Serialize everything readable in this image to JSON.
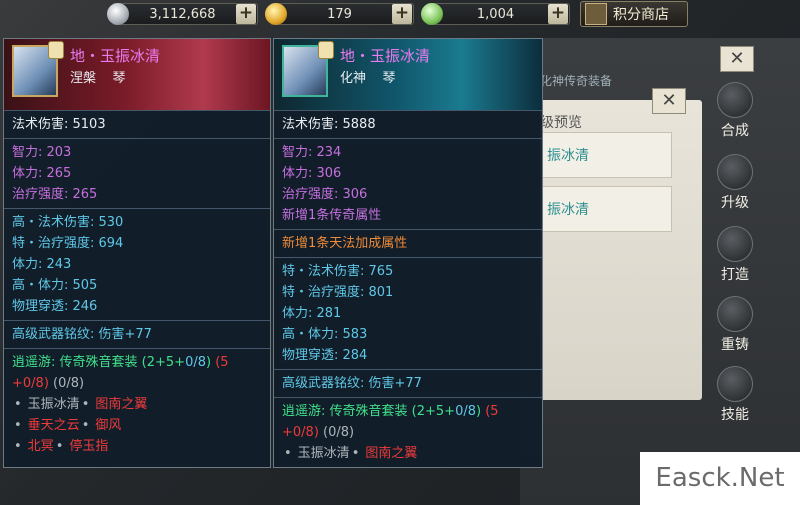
{
  "currency": {
    "silver": {
      "value": "3,112,668",
      "icon": "silver-coin-icon"
    },
    "gold": {
      "value": "179",
      "icon": "gold-ingot-icon"
    },
    "jade": {
      "value": "1,004",
      "icon": "jade-ingot-icon"
    },
    "plus": "+"
  },
  "shop_button": {
    "label": "积分商店"
  },
  "background": {
    "header": "化神传奇装备",
    "panel_title": "级预览",
    "items": [
      "振冰清",
      "振冰清"
    ],
    "close": "✕"
  },
  "side_nav": [
    "合成",
    "升级",
    "打造",
    "重铸",
    "技能"
  ],
  "watermark": "Easck.Net",
  "tooltip_left": {
    "name": "地・玉振冰清",
    "realm": "涅槃",
    "type": "琴",
    "base": "法术伤害: 5103",
    "stats": [
      "智力: 203",
      "体力: 265",
      "治疗强度: 265"
    ],
    "advanced": [
      "高・法术伤害: 530",
      "特・治疗强度: 694",
      "体力: 243",
      "高・体力: 505",
      "物理穿透: 246"
    ],
    "inscription": "高级武器铭纹: 伤害+77",
    "set": {
      "prefix": "逍遥游: 传奇殊音套装",
      "counts_a": "(2+5+",
      "counts_b": "0/8",
      "counts_c": ")",
      "counts_d": "(5",
      "counts_e": "+0/8)",
      "counts_f": "(0/8)"
    },
    "set_items": [
      [
        "玉振冰清",
        "图南之翼"
      ],
      [
        "垂天之云",
        "御风"
      ],
      [
        "北冥",
        "停玉指"
      ]
    ]
  },
  "tooltip_right": {
    "name": "地・玉振冰清",
    "realm": "化神",
    "type": "琴",
    "base": "法术伤害: 5888",
    "stats": [
      "智力: 234",
      "体力: 306",
      "治疗强度: 306"
    ],
    "new_legend": "新增1条传奇属性",
    "new_skill": "新增1条天法加成属性",
    "advanced": [
      "特・法术伤害: 765",
      "特・治疗强度: 801",
      "体力: 281",
      "高・体力: 583",
      "物理穿透: 284"
    ],
    "inscription": "高级武器铭纹: 伤害+77",
    "set": {
      "prefix": "逍遥游: 传奇殊音套装",
      "counts_a": "(2+5+",
      "counts_b": "0/8",
      "counts_c": ")",
      "counts_d": "(5",
      "counts_e": "+0/8)",
      "counts_f": "(0/8)"
    },
    "set_items": [
      [
        "玉振冰清",
        "图南之翼"
      ]
    ]
  }
}
